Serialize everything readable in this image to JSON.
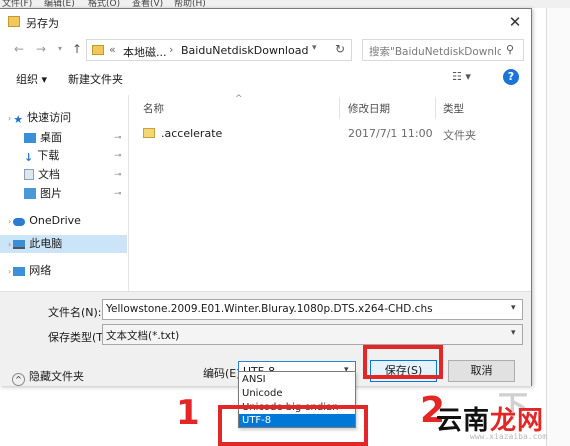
{
  "background_menu": [
    "文件(F)",
    "编辑(E)",
    "格式(O)",
    "查看(V)",
    "帮助(H)"
  ],
  "dialog": {
    "title": "另存为",
    "close_symbol": "✕"
  },
  "address_bar": {
    "chevron": "«",
    "segments": [
      "本地磁...",
      "BaiduNetdiskDownload"
    ],
    "separator": "›",
    "refresh_symbol": "↻"
  },
  "search": {
    "placeholder": "搜索\"BaiduNetdiskDownlo..."
  },
  "toolbar": {
    "organize": "组织 ▾",
    "new_folder": "新建文件夹",
    "view_symbol": "☷ ▾",
    "help_symbol": "?"
  },
  "nav_pane": {
    "items": [
      {
        "label": "快速访问",
        "icon": "star-icon",
        "color": "#1e73c8"
      },
      {
        "label": "桌面",
        "icon": "desktop-icon",
        "color": "#3a8fd8",
        "pinned": true
      },
      {
        "label": "下载",
        "icon": "download-icon",
        "color": "#2b7bd0",
        "pinned": true
      },
      {
        "label": "文档",
        "icon": "document-icon",
        "color": "#8aa0b8",
        "pinned": true
      },
      {
        "label": "图片",
        "icon": "picture-icon",
        "color": "#4a98d8",
        "pinned": true
      },
      {
        "label": "OneDrive",
        "icon": "cloud-icon",
        "color": "#2b7bd0"
      },
      {
        "label": "此电脑",
        "icon": "computer-icon",
        "color": "#3a8fd8",
        "selected": true
      },
      {
        "label": "网络",
        "icon": "network-icon",
        "color": "#3a8fd8"
      }
    ],
    "pin_symbol": "📌"
  },
  "file_list": {
    "columns": [
      "名称",
      "修改日期",
      "类型"
    ],
    "rows": [
      {
        "name": ".accelerate",
        "date": "2017/7/1 11:00",
        "type": "文件夹"
      }
    ]
  },
  "form": {
    "filename_label": "文件名(N):",
    "filename_value": "Yellowstone.2009.E01.Winter.Bluray.1080p.DTS.x264-CHD.chs",
    "filetype_label": "保存类型(T):",
    "filetype_value": "文本文档(*.txt)",
    "hide_folders": "隐藏文件夹",
    "encoding_label": "编码(E):",
    "encoding_value": "UTF-8",
    "save_button": "保存(S)",
    "cancel_button": "取消",
    "encoding_options": [
      "ANSI",
      "Unicode",
      "Unicode big endian",
      "UTF-8"
    ],
    "selected_encoding": "UTF-8"
  },
  "annotations": {
    "mark1": "1",
    "mark2": "2",
    "accent": "#e32626"
  },
  "watermark": {
    "brand_a": "云南",
    "brand_b": "龙网",
    "url": "www.xiazaiba.com"
  }
}
